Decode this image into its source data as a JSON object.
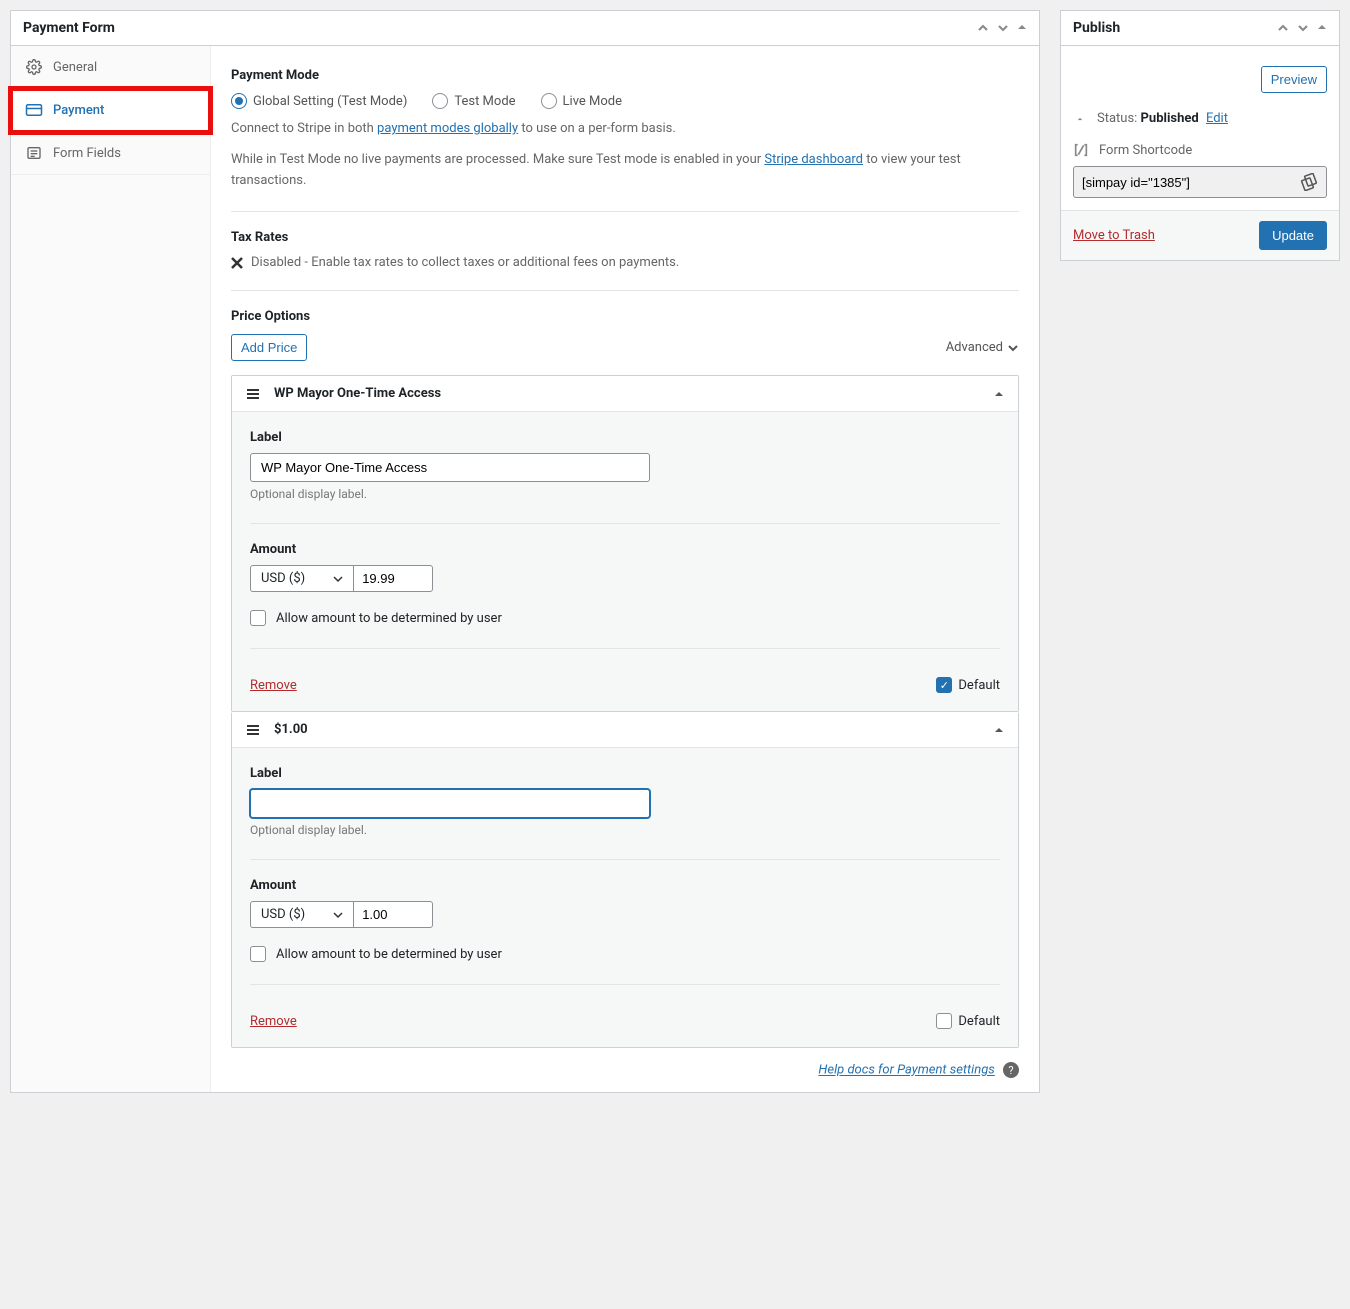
{
  "main": {
    "title": "Payment Form",
    "tabs": {
      "general": "General",
      "payment": "Payment",
      "form_fields": "Form Fields"
    },
    "payment_mode": {
      "heading": "Payment Mode",
      "options": [
        "Global Setting (Test Mode)",
        "Test Mode",
        "Live Mode"
      ],
      "help1a": "Connect to Stripe in both ",
      "help1_link": "payment modes globally",
      "help1b": " to use on a per-form basis.",
      "help2a": "While in Test Mode no live payments are processed. Make sure Test mode is enabled in your ",
      "help2_link": "Stripe dashboard",
      "help2b": " to view your test transactions."
    },
    "tax": {
      "heading": "Tax Rates",
      "disabled": "Disabled - ",
      "link": "Enable tax rates",
      "after": " to collect taxes or additional fees on payments."
    },
    "price": {
      "heading": "Price Options",
      "add_btn": "Add Price",
      "advanced": "Advanced"
    },
    "cards": [
      {
        "title": "WP Mayor One-Time Access",
        "label_heading": "Label",
        "label_value": "WP Mayor One-Time Access",
        "label_hint": "Optional display label.",
        "amount_heading": "Amount",
        "currency": "USD ($)",
        "amount": "19.99",
        "allow_custom": "Allow amount to be determined by user",
        "remove": "Remove",
        "default_label": "Default",
        "default_checked": true,
        "label_focused": false
      },
      {
        "title": "$1.00",
        "label_heading": "Label",
        "label_value": "",
        "label_hint": "Optional display label.",
        "amount_heading": "Amount",
        "currency": "USD ($)",
        "amount": "1.00",
        "allow_custom": "Allow amount to be determined by user",
        "remove": "Remove",
        "default_label": "Default",
        "default_checked": false,
        "label_focused": true
      }
    ],
    "footer_help": "Help docs for Payment settings"
  },
  "publish": {
    "title": "Publish",
    "preview": "Preview",
    "status_label": "Status: ",
    "status_value": "Published",
    "edit": "Edit",
    "shortcode_label": "Form Shortcode",
    "shortcode_value": "[simpay id=\"1385\"]",
    "trash": "Move to Trash",
    "update": "Update"
  }
}
